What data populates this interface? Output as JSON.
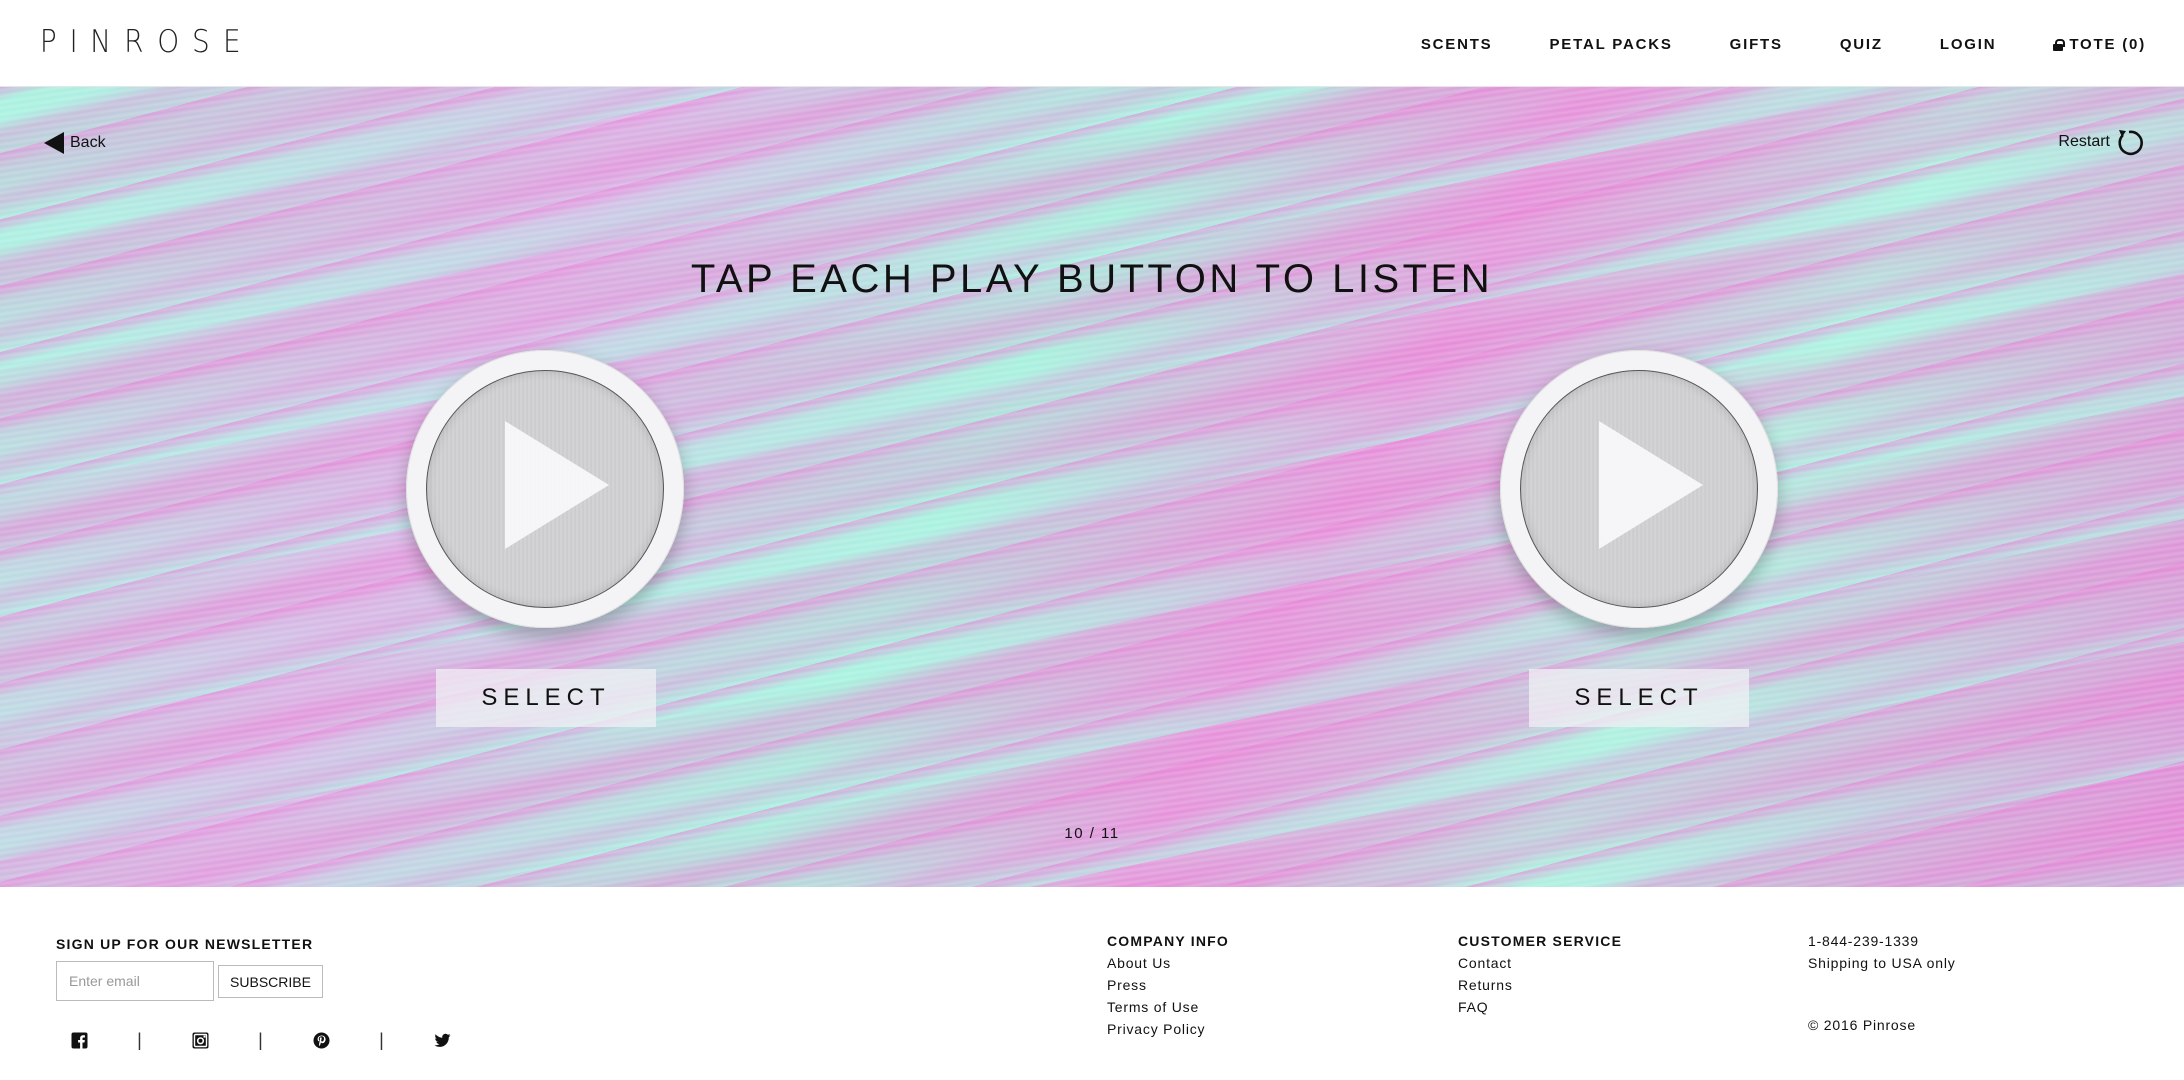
{
  "header": {
    "logo_letters": [
      "P",
      "I",
      "N",
      "R",
      "O",
      "S",
      "E"
    ],
    "nav": [
      "SCENTS",
      "PETAL PACKS",
      "GIFTS",
      "QUIZ",
      "LOGIN"
    ],
    "tote_label": "TOTE (0)"
  },
  "hero": {
    "back_label": "Back",
    "restart_label": "Restart",
    "title": "TAP EACH PLAY BUTTON TO LISTEN",
    "left_select": "SELECT",
    "right_select": "SELECT",
    "progress": "10 / 11"
  },
  "footer": {
    "newsletter_title": "SIGN UP FOR OUR NEWSLETTER",
    "email_placeholder": "Enter email",
    "subscribe_label": "SUBSCRIBE",
    "separator": "|",
    "company": {
      "title": "COMPANY INFO",
      "links": [
        "About Us",
        "Press",
        "Terms of Use",
        "Privacy Policy"
      ]
    },
    "service": {
      "title": "CUSTOMER SERVICE",
      "links": [
        "Contact",
        "Returns",
        "FAQ"
      ]
    },
    "contact": {
      "phone": "1-844-239-1339",
      "shipping": "Shipping to USA only",
      "copyright": "© 2016 Pinrose"
    },
    "social_icons": [
      "facebook-icon",
      "instagram-icon",
      "pinterest-icon",
      "twitter-icon"
    ]
  }
}
